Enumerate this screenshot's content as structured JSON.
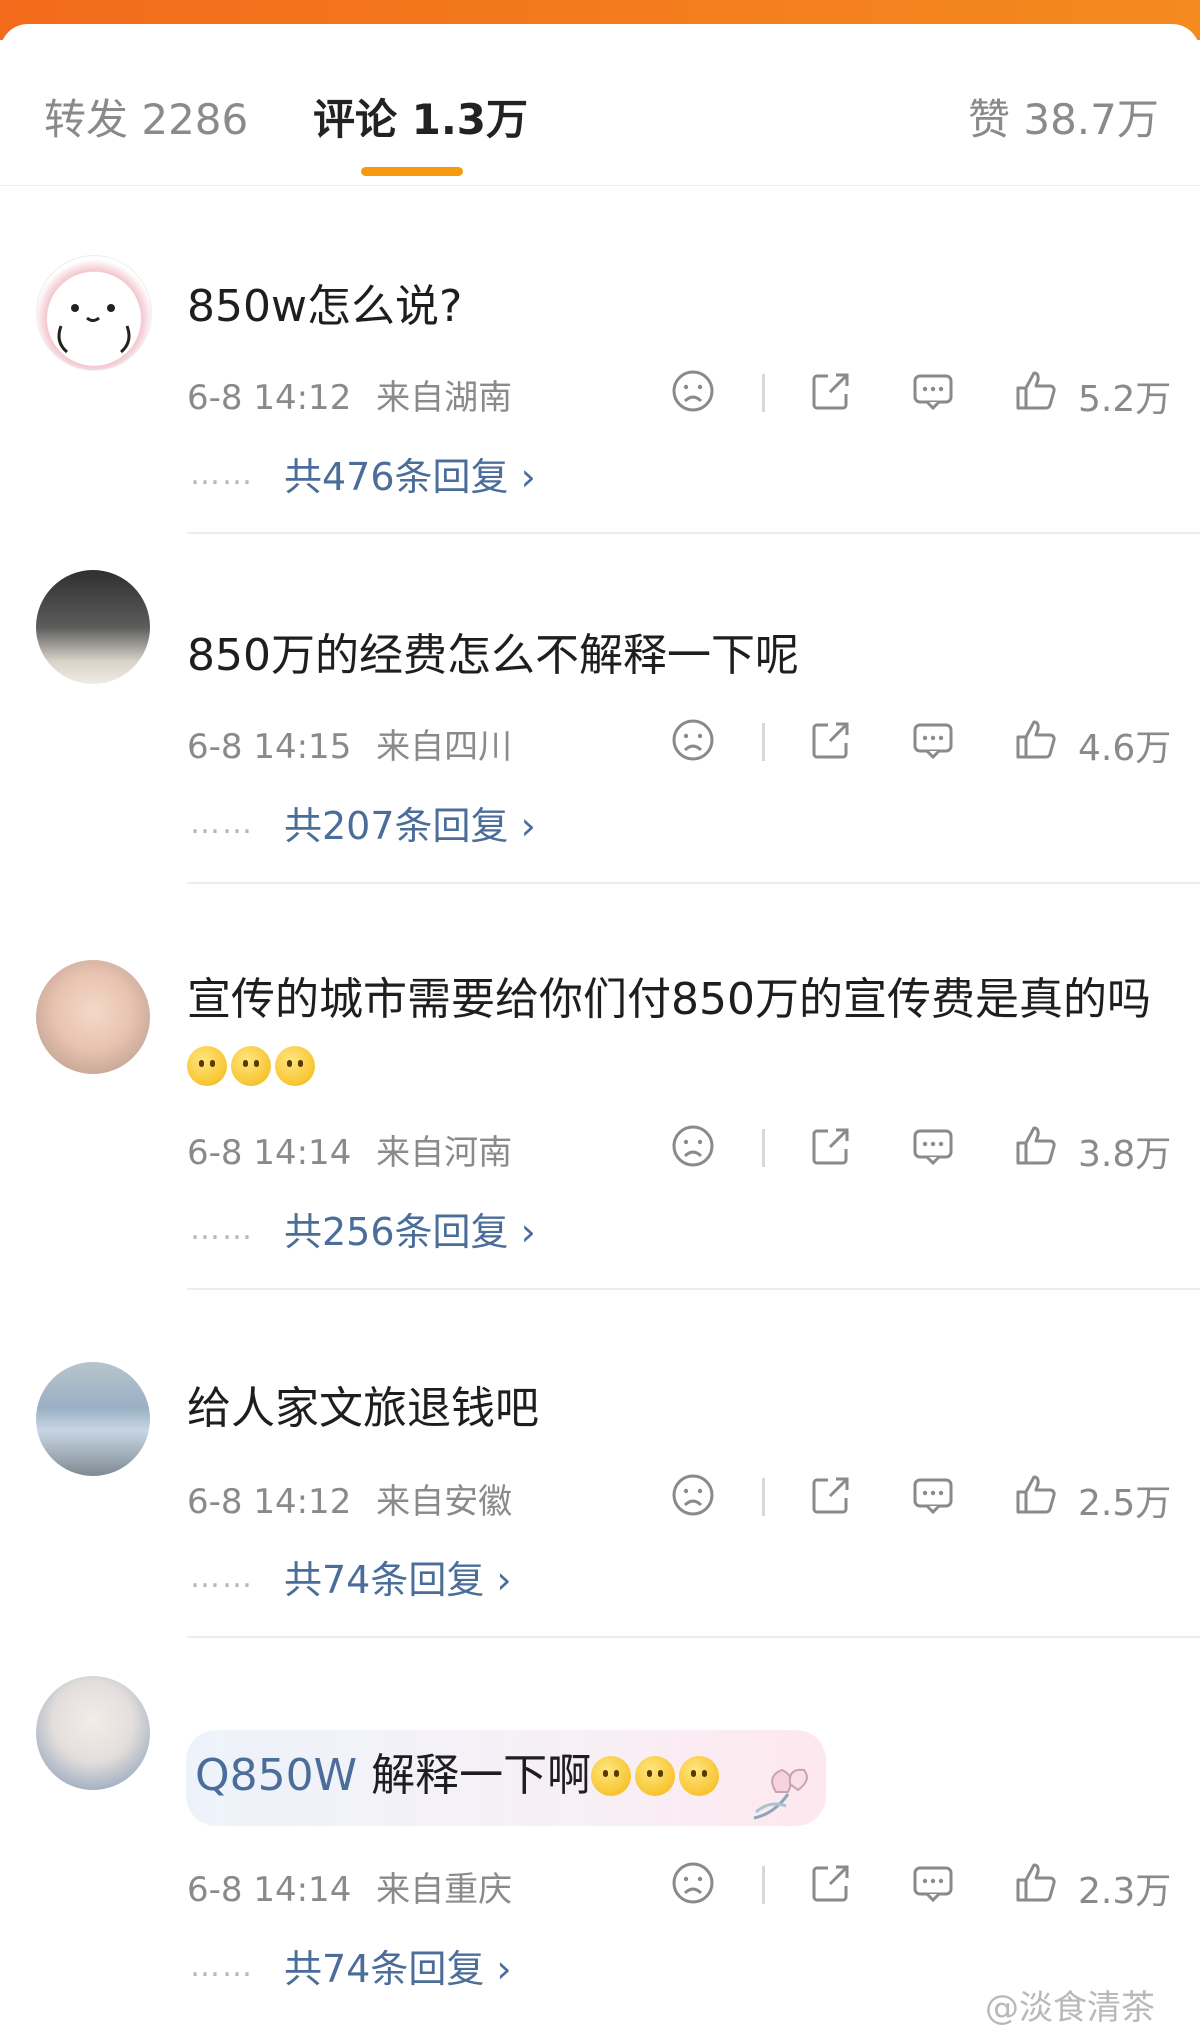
{
  "tabs": {
    "repost": "转发 2286",
    "comments": "评论 1.3万",
    "likes": "赞 38.7万"
  },
  "comments": [
    {
      "text": "850w怎么说?",
      "time": "6-8 14:12",
      "location": "来自湖南",
      "likes": "5.2万",
      "replies": "共476条回复 ›"
    },
    {
      "text": "850万的经费怎么不解释一下呢",
      "time": "6-8 14:15",
      "location": "来自四川",
      "likes": "4.6万",
      "replies": "共207条回复 ›"
    },
    {
      "text": "宣传的城市需要给你们付850万的宣传费是真的吗",
      "time": "6-8 14:14",
      "location": "来自河南",
      "likes": "3.8万",
      "replies": "共256条回复 ›"
    },
    {
      "text": "给人家文旅退钱吧",
      "time": "6-8 14:12",
      "location": "来自安徽",
      "likes": "2.5万",
      "replies": "共74条回复 ›"
    },
    {
      "text_search": "Q850W",
      "text": " 解释一下啊",
      "time": "6-8 14:14",
      "location": "来自重庆",
      "likes": "2.3万",
      "replies": "共74条回复 ›"
    }
  ],
  "watermark": "@淡食清茶",
  "colors": {
    "accent": "#f59a0f",
    "reply_link": "#4b6d9a",
    "header_gradient": "#f26b1c"
  }
}
